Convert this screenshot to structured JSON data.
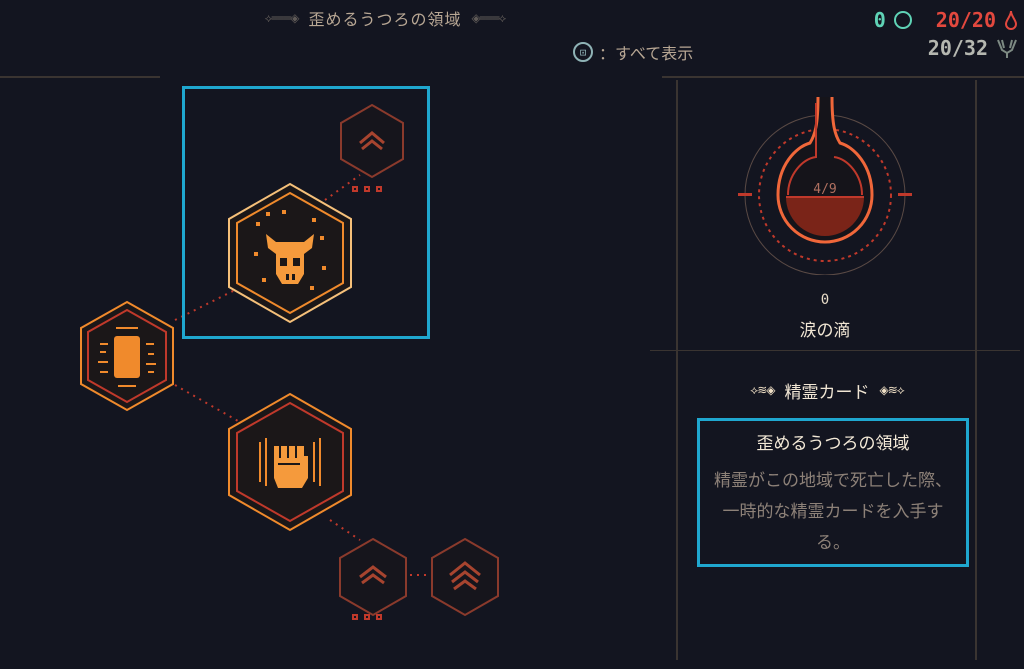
{
  "header": {
    "title": "歪めるうつろの領域",
    "show_all_button": "⊡",
    "show_all_label": "：すべて表示"
  },
  "stats": {
    "currency_value": "0",
    "health": "20/20",
    "capacity": "20/32"
  },
  "vial": {
    "fill_label": "4/9",
    "fill_fraction": 0.444,
    "count": "0",
    "name": "涙の滴"
  },
  "detail": {
    "category": "精霊カード",
    "title": "歪めるうつろの領域",
    "description": "精霊がこの地域で死亡した際、一時的な精霊カードを入手する。"
  },
  "colors": {
    "accent_selection": "#1fa7cf",
    "node_orange": "#f08a2c",
    "node_red": "#c0392b",
    "health_red": "#e3483e",
    "currency_teal": "#5fd3b6"
  },
  "icons": {
    "show_all": "controller-button-icon",
    "currency": "ring-icon",
    "health": "blood-drop-icon",
    "capacity": "trident-icon"
  }
}
